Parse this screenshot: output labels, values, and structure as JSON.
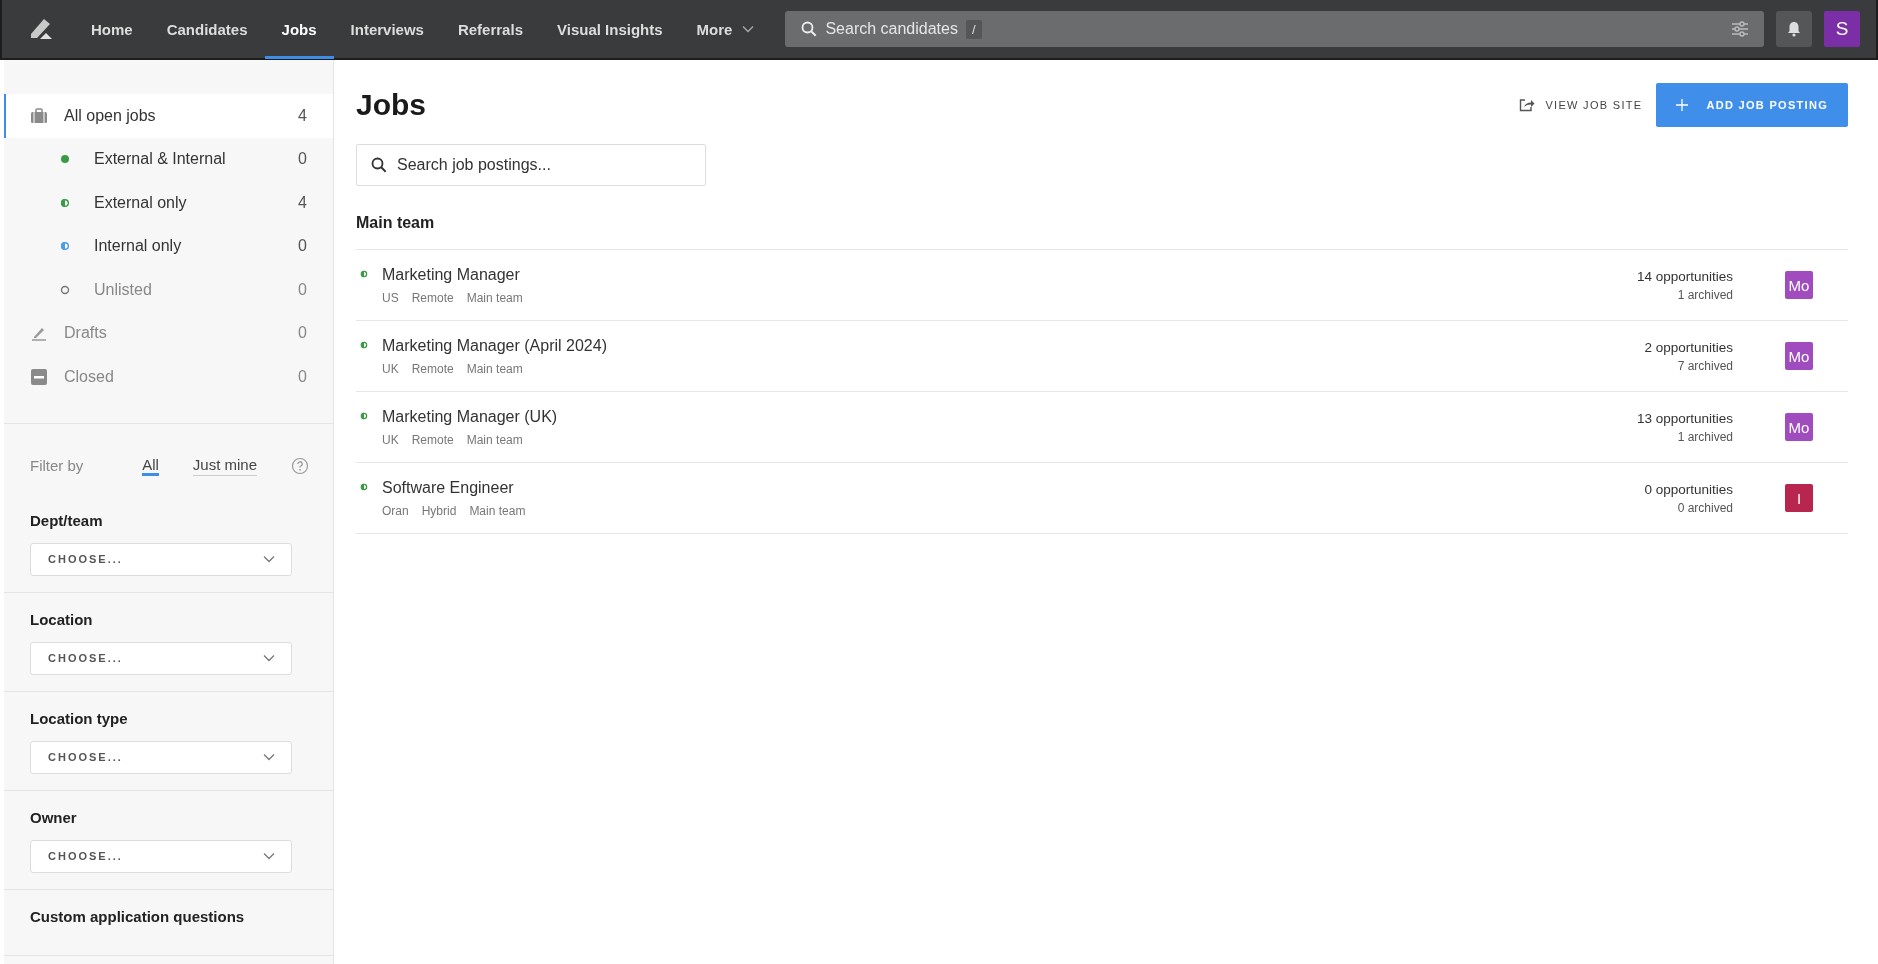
{
  "nav": {
    "items": [
      {
        "label": "Home",
        "selected": false,
        "caret": false
      },
      {
        "label": "Candidates",
        "selected": false,
        "caret": false
      },
      {
        "label": "Jobs",
        "selected": true,
        "caret": false
      },
      {
        "label": "Interviews",
        "selected": false,
        "caret": false
      },
      {
        "label": "Referrals",
        "selected": false,
        "caret": false
      },
      {
        "label": "Visual Insights",
        "selected": false,
        "caret": false
      },
      {
        "label": "More",
        "selected": false,
        "caret": true
      }
    ],
    "search": {
      "placeholder": "Search candidates",
      "shortcut": "/"
    },
    "avatar": {
      "initial": "S",
      "color": "#7b2fa6"
    }
  },
  "sidebar": {
    "items": [
      {
        "kind": "all",
        "label": "All open jobs",
        "count": "4",
        "selected": true,
        "muted": false
      },
      {
        "kind": "dot-full",
        "label": "External & Internal",
        "count": "0",
        "selected": false,
        "muted": false,
        "color": "#3a9b47"
      },
      {
        "kind": "dot-half",
        "label": "External only",
        "count": "4",
        "selected": false,
        "muted": false,
        "color": "#3a9b47"
      },
      {
        "kind": "dot-half",
        "label": "Internal only",
        "count": "0",
        "selected": false,
        "muted": false,
        "color": "#4a9be8"
      },
      {
        "kind": "dot-empty",
        "label": "Unlisted",
        "count": "0",
        "selected": false,
        "muted": true,
        "color": "#777777"
      },
      {
        "kind": "drafts",
        "label": "Drafts",
        "count": "0",
        "selected": false,
        "muted": true
      },
      {
        "kind": "closed",
        "label": "Closed",
        "count": "0",
        "selected": false,
        "muted": true
      }
    ],
    "filter_by": {
      "label": "Filter by",
      "options": [
        {
          "label": "All",
          "selected": true
        },
        {
          "label": "Just mine",
          "selected": false
        }
      ]
    },
    "filters": [
      {
        "label": "Dept/team",
        "placeholder": "CHOOSE..."
      },
      {
        "label": "Location",
        "placeholder": "CHOOSE..."
      },
      {
        "label": "Location type",
        "placeholder": "CHOOSE..."
      },
      {
        "label": "Owner",
        "placeholder": "CHOOSE..."
      },
      {
        "label": "Custom application questions"
      }
    ]
  },
  "main": {
    "title": "Jobs",
    "view_site": "VIEW JOB SITE",
    "add_button": "ADD JOB POSTING",
    "search": {
      "placeholder": "Search job postings..."
    },
    "group": "Main team",
    "jobs": [
      {
        "title": "Marketing Manager",
        "tags": [
          "US",
          "Remote",
          "Main team"
        ],
        "opportunities": "14 opportunities",
        "archived": "1 archived",
        "owner": "Mo",
        "color": "#a04cbf"
      },
      {
        "title": "Marketing Manager (April 2024)",
        "tags": [
          "UK",
          "Remote",
          "Main team"
        ],
        "opportunities": "2 opportunities",
        "archived": "7 archived",
        "owner": "Mo",
        "color": "#a04cbf"
      },
      {
        "title": "Marketing Manager (UK)",
        "tags": [
          "UK",
          "Remote",
          "Main team"
        ],
        "opportunities": "13 opportunities",
        "archived": "1 archived",
        "owner": "Mo",
        "color": "#a04cbf"
      },
      {
        "title": "Software Engineer",
        "tags": [
          "Oran",
          "Hybrid",
          "Main team"
        ],
        "opportunities": "0 opportunities",
        "archived": "0 archived",
        "owner": "I",
        "color": "#b8264f"
      }
    ]
  }
}
